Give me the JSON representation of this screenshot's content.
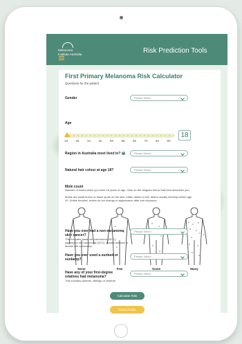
{
  "header": {
    "logo_line1": "Melanoma",
    "logo_line2": "Institute Australia",
    "title": "Risk Prediction Tools"
  },
  "calculator": {
    "title": "First Primary Melanoma Risk Calculator",
    "subtitle": "Questions for the patient"
  },
  "questions": {
    "gender": {
      "label": "Gender",
      "placeholder": "Please Select"
    },
    "age": {
      "label": "Age",
      "value": "18",
      "ticks": [
        "18",
        "26",
        "34",
        "42",
        "50",
        "58",
        "66",
        "74",
        "82",
        "90"
      ]
    },
    "region": {
      "label": "Region in Australia most lived in?",
      "placeholder": "Please Select"
    },
    "hair": {
      "label": "Natural hair colour at age 18?",
      "placeholder": "Please Select"
    },
    "moles": {
      "label": "Mole count",
      "desc1": "Number of moles when you were 18 years of age. Click on the diagram below that best describes you.",
      "desc2": "Moles are small brown or black spots on the skin, either raised or flat. Moles usually develop before age 20. Unlike freckles, moles do not change in appearance after sun exposure.",
      "options": [
        "None",
        "Few",
        "Some",
        "Many"
      ]
    },
    "skin_cancer": {
      "label": "Have you ever had a non-melanoma skin cancer?",
      "desc": "This includes basal cell carcinoma (BCC), squamous cell carcinoma (SCC), Bowen disease or Merkel cell carcinoma.",
      "placeholder": "Please Select"
    },
    "sunbed": {
      "label": "Have you ever used a sunbed or sunlamp?",
      "placeholder": "Please Select"
    },
    "relatives": {
      "label": "Have any of your first-degree relatives had melanoma?",
      "desc": "This includes parents, siblings or children.",
      "placeholder": "Please Select"
    }
  },
  "actions": {
    "calculate": "Calculate Risk",
    "reset": "Reset Fields"
  },
  "colors": {
    "brand": "#4e8a78",
    "accent": "#f2b82f",
    "reset": "#f2c34a"
  }
}
